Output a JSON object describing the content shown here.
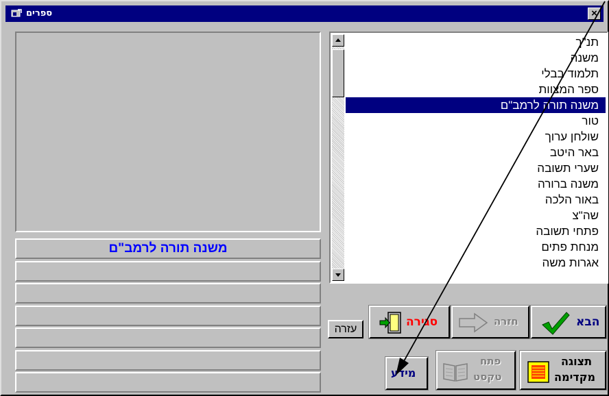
{
  "window": {
    "title": "ספרים",
    "close_symbol": "×"
  },
  "books": {
    "items": [
      "תנ\"ך",
      "משנה",
      "תלמוד בבלי",
      "ספר המצוות",
      "משנה תורה לרמב\"ם",
      "טור",
      "שולחן ערוך",
      "באר היטב",
      "שערי תשובה",
      "משנה ברורה",
      "באור הלכה",
      "שה\"צ",
      "פתחי תשובה",
      "מנחת פתים",
      "אגרות משה"
    ],
    "selected_index": 4
  },
  "info": {
    "selected_title": "משנה תורה לרמב\"ם"
  },
  "buttons": {
    "next": "הבא",
    "back": "חזרה",
    "close": "סגירה",
    "help": "עזרה",
    "preview_line1": "תצוגה",
    "preview_line2": "מקדימה",
    "open_text_line1": "פתח",
    "open_text_line2": "טקסט",
    "info": "מידע"
  },
  "colors": {
    "titlebar": "#000080",
    "selection": "#000080",
    "info_text": "#0000ff",
    "close_text": "#ff0000",
    "check": "#00a000"
  }
}
